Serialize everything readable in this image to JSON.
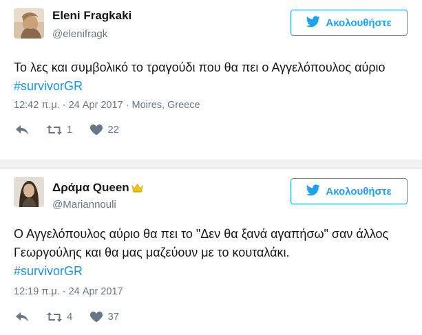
{
  "tweets": [
    {
      "name": "Eleni Fragkaki",
      "handle": "@elenifragk",
      "follow_label": "Ακολουθήστε",
      "text": "Το λες και συμβολικό το τραγούδι που θα πει ο Αγγελόπουλος αύριο",
      "hashtag": "#survivorGR",
      "meta": "12:42 π.μ. - 24 Apr 2017 · Moires, Greece",
      "retweets": "1",
      "likes": "22",
      "icons": [
        "reply-icon",
        "retweet-icon",
        "like-icon"
      ]
    },
    {
      "name": "Δράμα Queen",
      "name_badge": "crown-icon",
      "handle": "@Mariannouli",
      "follow_label": "Ακολουθήστε",
      "text": "Ο Αγγελόπουλος αύριο θα πει το \"Δεν θα ξανά αγαπήσω\" σαν άλλος Γεωργούλης και θα μας μαζεύουν με το κουταλάκι.",
      "hashtag": "#survivorGR",
      "meta": "12:19 π.μ. - 24 Apr 2017",
      "retweets": "4",
      "likes": "37",
      "icons": [
        "reply-icon",
        "retweet-icon",
        "like-icon"
      ]
    }
  ],
  "colors": {
    "accent": "#1da1f2",
    "hashtag": "#1b95e0",
    "muted": "#657786",
    "text": "#14171a",
    "crown": "#f5c518"
  }
}
